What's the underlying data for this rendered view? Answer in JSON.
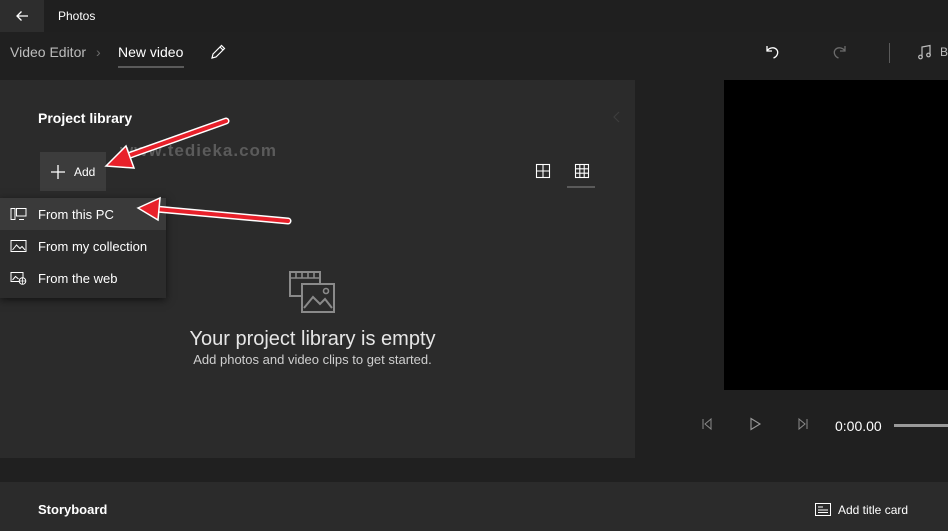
{
  "window": {
    "app_title": "Photos"
  },
  "breadcrumb": {
    "root": "Video Editor",
    "separator": "›",
    "current": "New video"
  },
  "header": {
    "music_label": "B"
  },
  "library": {
    "title": "Project library",
    "add_label": "Add",
    "watermark": "www.tedieka.com",
    "empty_title": "Your project library is empty",
    "empty_subtitle": "Add photos and video clips to get started."
  },
  "add_menu": {
    "items": [
      {
        "label": "From this PC",
        "icon": "pc-icon"
      },
      {
        "label": "From my collection",
        "icon": "collection-icon"
      },
      {
        "label": "From the web",
        "icon": "web-icon"
      }
    ]
  },
  "preview": {
    "time": "0:00.00"
  },
  "storyboard": {
    "title": "Storyboard",
    "add_title_card_label": "Add title card"
  },
  "colors": {
    "background": "#202020",
    "panel": "#2b2b2b",
    "annotation_arrow": "#e8202a"
  }
}
